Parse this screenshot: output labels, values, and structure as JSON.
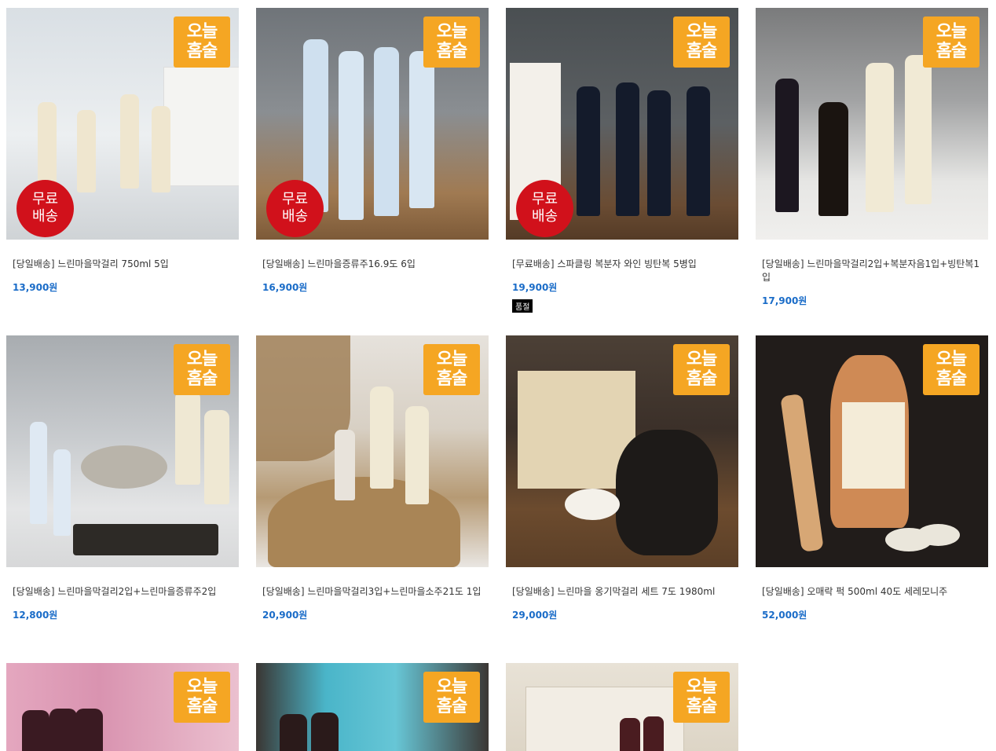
{
  "badge_text": [
    "오늘",
    "홈술"
  ],
  "free_shipping_text": [
    "무료",
    "배송"
  ],
  "products": [
    {
      "name": "[당일배송] 느린마을막걸리 750ml 5입",
      "price": "13,900원"
    },
    {
      "name": "[당일배송] 느린마을증류주16.9도 6입",
      "price": "16,900원"
    },
    {
      "name": "[무료배송] 스파클링 복분자 와인 빙탄복 5병입",
      "price": "19,900원",
      "status": "품절"
    },
    {
      "name": "[당일배송] 느린마을막걸리2입+복분자음1입+빙탄복1입",
      "price": "17,900원"
    },
    {
      "name": "[당일배송] 느린마을막걸리2입+느린마을증류주2입",
      "price": "12,800원"
    },
    {
      "name": "[당일배송] 느린마을막걸리3입+느린마을소주21도 1입",
      "price": "20,900원"
    },
    {
      "name": "[당일배송] 느린마을 옹기막걸리 세트 7도 1980ml",
      "price": "29,000원"
    },
    {
      "name": "[당일배송] 오매락 퍽 500ml 40도 세레모니주",
      "price": "52,000원"
    }
  ],
  "colors": {
    "badge": "#f5a623",
    "free_badge": "#d1111b",
    "price": "#1a6cc8"
  }
}
